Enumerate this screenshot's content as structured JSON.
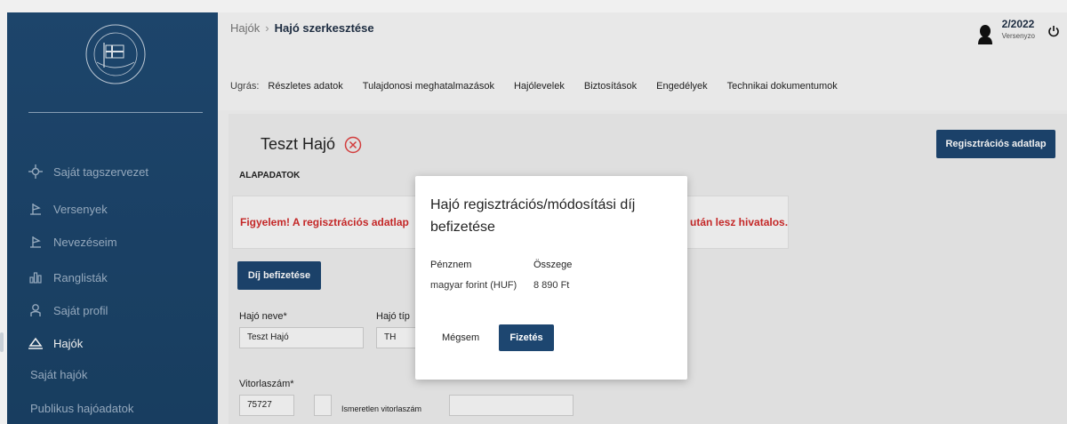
{
  "breadcrumb": {
    "parent": "Hajók",
    "separator": "›",
    "current": "Hajó szerkesztése"
  },
  "user": {
    "season": "2/2022",
    "role": "Versenyzo"
  },
  "jump": {
    "label": "Ugrás:",
    "links": [
      "Részletes adatok",
      "Tulajdonosi meghatalmazások",
      "Hajólevelek",
      "Biztosítások",
      "Engedélyek",
      "Technikai dokumentumok"
    ]
  },
  "sidebar": {
    "items": [
      {
        "label": "Saját tagszervezet",
        "icon": "crosshair-icon"
      },
      {
        "label": "Versenyek",
        "icon": "flag-icon"
      },
      {
        "label": "Nevezéseim",
        "icon": "flag-icon"
      },
      {
        "label": "Ranglisták",
        "icon": "bar-chart-icon"
      },
      {
        "label": "Saját profil",
        "icon": "user-icon"
      },
      {
        "label": "Hajók",
        "icon": "boat-icon"
      }
    ],
    "subitems": [
      "Saját hajók",
      "Publikus hajóadatok"
    ]
  },
  "page": {
    "boat_title": "Teszt Hajó",
    "reg_button": "Regisztrációs adatlap",
    "section": "ALAPADATOK",
    "warning_start": "Figyelem! A regisztrációs adatlap",
    "warning_end": "után lesz hivatalos.",
    "fee_button": "Díj befizetése",
    "fields": {
      "name_label": "Hajó neve*",
      "name_value": "Teszt Hajó",
      "type_label": "Hajó típ",
      "type_value": "TH",
      "sail_label": "Vitorlaszám*",
      "sail_value": "75727",
      "unknown_sail_label": "Ismeretlen vitorlaszám"
    }
  },
  "modal": {
    "title": "Hajó regisztrációs/módosítási díj befizetése",
    "currency_header": "Pénznem",
    "amount_header": "Összege",
    "currency_value": "magyar forint (HUF)",
    "amount_value": "8 890 Ft",
    "cancel": "Mégsem",
    "pay": "Fizetés"
  },
  "colors": {
    "primary": "#1d4670",
    "sidebar": "#1f4a72",
    "warning": "#d12b2b"
  }
}
